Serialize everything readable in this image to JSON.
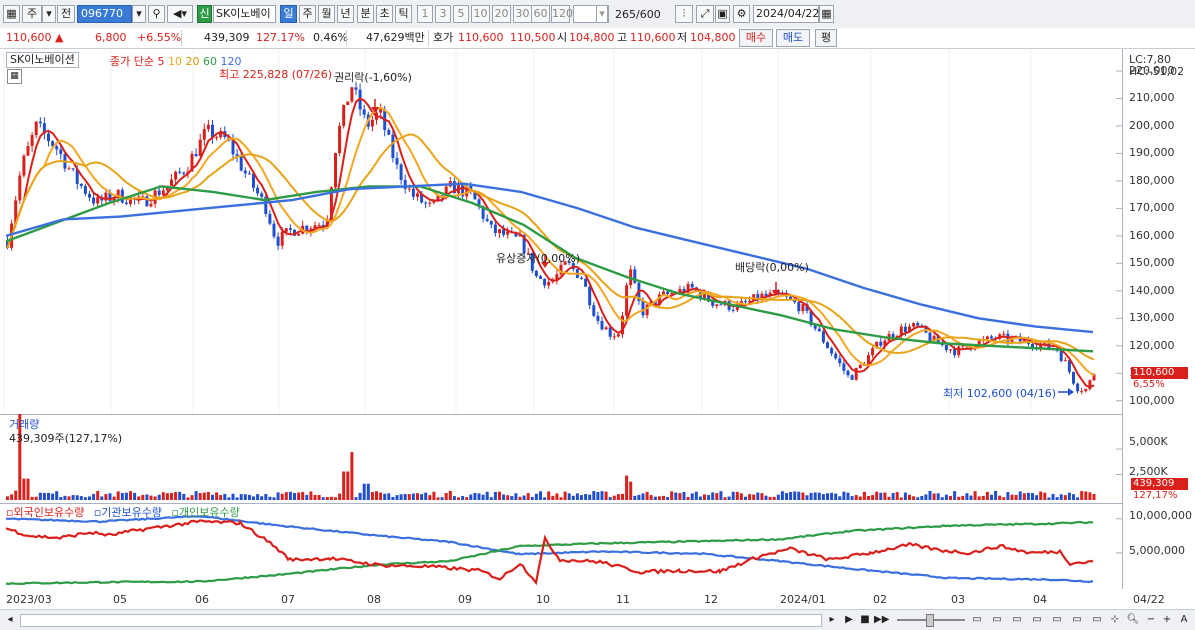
{
  "toolbar": {
    "period_main": "주",
    "prefix": "전",
    "stock_code": "096770",
    "new_badge": "신",
    "stock_name": "SK이노베이",
    "period_tabs": [
      "일",
      "주",
      "월",
      "년",
      "분",
      "초",
      "틱"
    ],
    "num_tabs": [
      "1",
      "3",
      "5",
      "10",
      "20",
      "30",
      "60",
      "120"
    ],
    "count": "265",
    "count_total": "/600",
    "date": "2024/04/22"
  },
  "pricebar": {
    "price": "110,600",
    "change": "6,800",
    "change_pct": "+6.55%",
    "volume": "439,309",
    "volume_ratio": "127.17%",
    "turnover": "0.46%",
    "amount": "47,629백만",
    "quote_label": "호가",
    "ask": "110,600",
    "bid": "110,500",
    "open_label": "시",
    "open": "104,800",
    "high_label": "고",
    "high": "110,600",
    "low_label": "저",
    "low": "104,800",
    "buy_btn": "매수",
    "sell_btn": "매도",
    "eval_btn": "평"
  },
  "price_chart": {
    "stock_label": "SK이노베이션",
    "ma_title": "종가 단순",
    "ma_periods": [
      "5",
      "10",
      "20",
      "60",
      "120"
    ],
    "high_note": "최고 225,828 (07/26)",
    "event1": "권리락(-1,60%)",
    "event2": "유상증자(0,00%)",
    "event3": "배당락(0,00%)",
    "low_note": "최저 102,600 (04/16)",
    "lc": "LC:7,80",
    "hc": "HC:-51,02",
    "y_ticks": [
      "220,000",
      "210,000",
      "200,000",
      "190,000",
      "180,000",
      "170,000",
      "160,000",
      "150,000",
      "140,000",
      "130,000",
      "120,000",
      "110,000",
      "100,000"
    ],
    "last_tag": "110,600",
    "pct_tag": "6,55%"
  },
  "volume_chart": {
    "title": "거래량",
    "note": "439,309주(127,17%)",
    "y_ticks": [
      "5,000K",
      "2,500K"
    ],
    "last_tag": "439,309",
    "pct_tag": "127,17%"
  },
  "holder_chart": {
    "legend": [
      "외국인보유수량",
      "기관보유수량",
      "개인보유수량"
    ],
    "y_ticks": [
      "10,000,000",
      "5,000,000"
    ]
  },
  "x_axis": {
    "labels": [
      "2023/03",
      "05",
      "06",
      "07",
      "08",
      "09",
      "10",
      "11",
      "12",
      "2024/01",
      "02",
      "03",
      "04"
    ],
    "right_label": "04/22"
  },
  "colors": {
    "up": "#d9201b",
    "down": "#1f4fcf",
    "ma5": "#d9201b",
    "ma10": "#f5a623",
    "ma20": "#e8a317",
    "ma60": "#2e9b45",
    "ma120": "#3a6fe0"
  },
  "chart_data": {
    "type": "candlestick",
    "title": "SK이노베이션",
    "xlabel": "",
    "ylabel": "",
    "ylim": [
      97000,
      228000
    ],
    "x": [
      "2023/03",
      "05",
      "06",
      "07",
      "08",
      "09",
      "10",
      "11",
      "12",
      "2024/01",
      "02",
      "03",
      "04",
      "04/22"
    ],
    "series": [
      {
        "name": "종가",
        "values": [
          158000,
          190000,
          175000,
          198000,
          180000,
          160000,
          215000,
          185000,
          175000,
          165000,
          140000,
          150000,
          122000,
          142000,
          138000,
          136000,
          118000,
          128000,
          120000,
          122000,
          118000,
          103000,
          110600
        ]
      },
      {
        "name": "60",
        "values": [
          158000,
          165000,
          172000,
          178000,
          176000,
          173000,
          176000,
          178000,
          178000,
          172000,
          164000,
          152000,
          145000,
          139000,
          135000,
          131000,
          126000,
          123000,
          121000,
          120000,
          119000,
          118000
        ]
      },
      {
        "name": "120",
        "values": [
          160000,
          166000,
          167000,
          169000,
          171000,
          173000,
          177000,
          178000,
          179000,
          176000,
          170000,
          163000,
          158000,
          153000,
          148000,
          141000,
          135000,
          130000,
          127000,
          125000
        ]
      }
    ]
  }
}
